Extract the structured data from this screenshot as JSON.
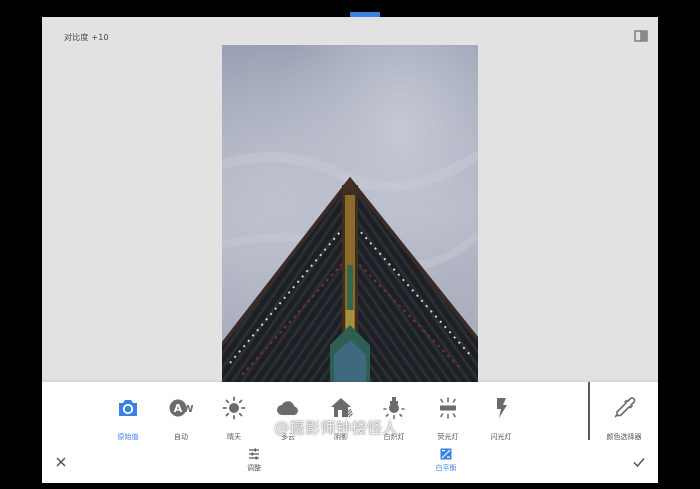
{
  "editor": {
    "contrast_status": "对比度 +10"
  },
  "white_balance": {
    "presets": [
      {
        "label": "原始值",
        "icon": "camera-icon",
        "active": true
      },
      {
        "label": "自动",
        "icon": "auto-wb-icon",
        "active": false
      },
      {
        "label": "晴天",
        "icon": "sun-icon",
        "active": false
      },
      {
        "label": "多云",
        "icon": "cloud-icon",
        "active": false
      },
      {
        "label": "阴影",
        "icon": "shade-icon",
        "active": false
      },
      {
        "label": "白炽灯",
        "icon": "bulb-icon",
        "active": false
      },
      {
        "label": "荧光灯",
        "icon": "fluorescent-icon",
        "active": false
      },
      {
        "label": "闪光灯",
        "icon": "flash-icon",
        "active": false
      }
    ],
    "color_picker_label": "颜色选择器"
  },
  "tabs": {
    "adjust": "调整",
    "white_balance": "白平衡"
  },
  "watermark": "@摄影师钟楼怪人",
  "colors": {
    "accent": "#3b82e6",
    "icon_gray": "#6b6b6b",
    "screen_bg": "#e2e2e2",
    "panel_bg": "#ffffff"
  }
}
